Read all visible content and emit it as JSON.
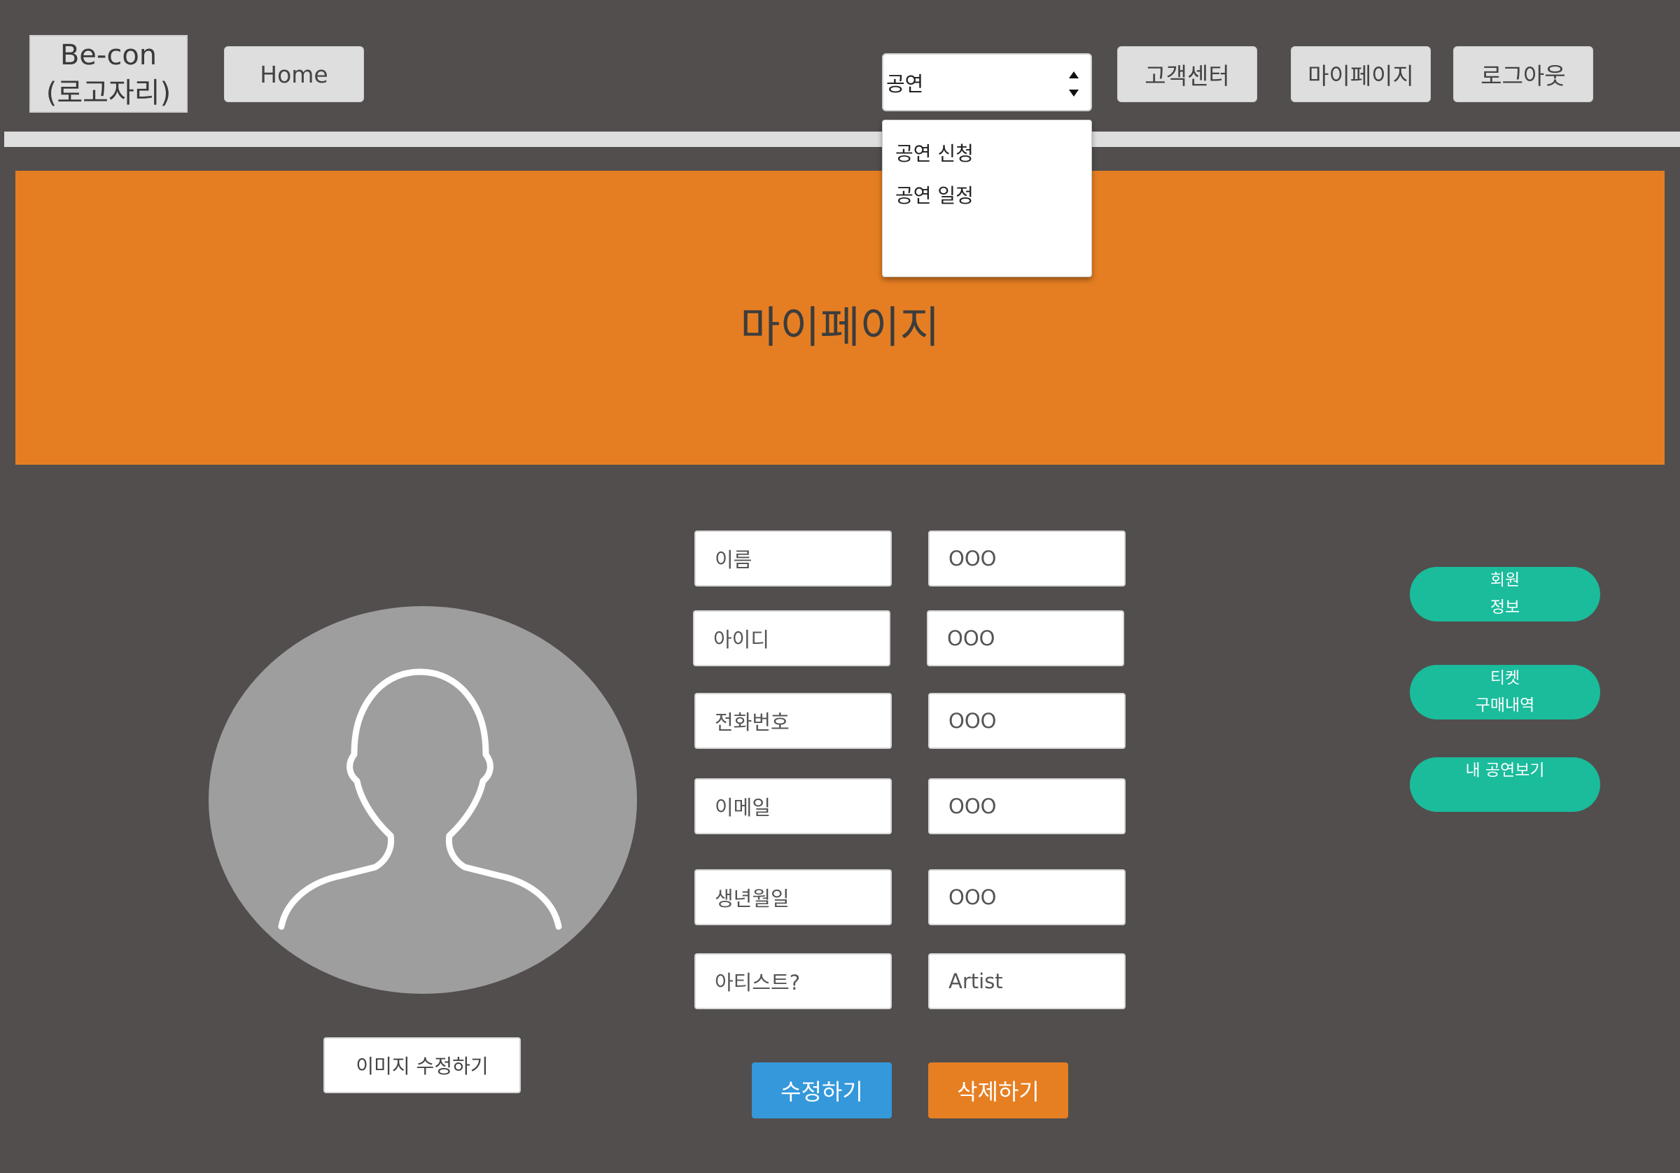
{
  "header": {
    "logo": {
      "line1": "Be-con",
      "line2": "(로고자리)"
    },
    "home_label": "Home",
    "select": {
      "value": "공연",
      "options": [
        "공연 신청",
        "공연 일정"
      ]
    },
    "nav": {
      "customer_center": "고객센터",
      "mypage": "마이페이지",
      "logout": "로그아웃"
    }
  },
  "banner": {
    "title": "마이페이지"
  },
  "profile": {
    "edit_image_label": "이미지 수정하기"
  },
  "form": {
    "rows": [
      {
        "label": "이름",
        "value": "OOO"
      },
      {
        "label": "아이디",
        "value": "OOO"
      },
      {
        "label": "전화번호",
        "value": "OOO"
      },
      {
        "label": "이메일",
        "value": "OOO"
      },
      {
        "label": "생년월일",
        "value": "OOO"
      },
      {
        "label": "아티스트?",
        "value": "Artist"
      }
    ],
    "edit_label": "수정하기",
    "delete_label": "삭제하기"
  },
  "side_menu": {
    "member_info": {
      "line1": "회원",
      "line2": "정보"
    },
    "ticket_history": {
      "line1": "티켓",
      "line2": "구매내역"
    },
    "my_shows": "내 공연보기"
  },
  "colors": {
    "background": "#524e4d",
    "banner": "#e57e22",
    "edit_button": "#3498db",
    "delete_button": "#e67e22",
    "pill": "#1abc9c"
  }
}
